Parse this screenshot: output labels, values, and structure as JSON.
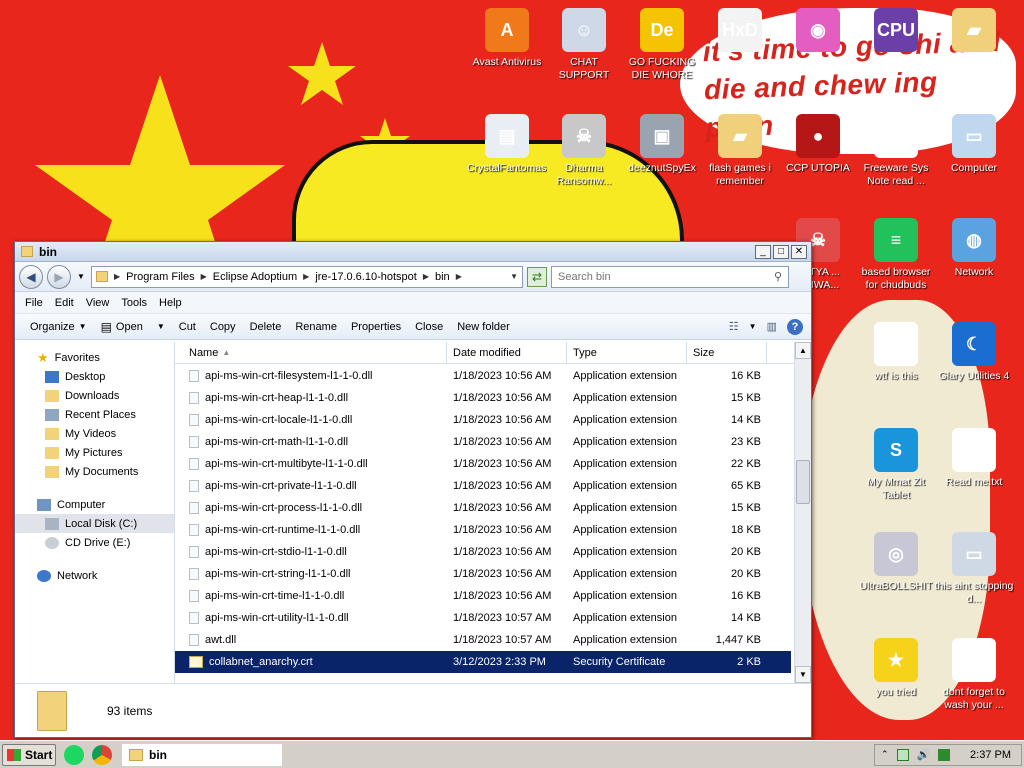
{
  "desktop": {
    "wallpaper_text": "it's time to go shi and die and chew ing pillin",
    "icons": [
      {
        "name": "avast-antivirus-icon",
        "label": "Avast Antivirus",
        "glyph": "A",
        "color": "#f07a1a"
      },
      {
        "name": "chat-support-icon",
        "label": "CHAT SUPPORT",
        "glyph": "☺",
        "color": "#cfd8e6"
      },
      {
        "name": "go-fucking-die-whore-icon",
        "label": "GO FUCKING DIE WHORE",
        "glyph": "De",
        "color": "#f5c400"
      },
      {
        "name": "hxd-icon",
        "label": "",
        "glyph": "HxD",
        "color": "#f3f3f3"
      },
      {
        "name": "colorful-app-icon",
        "label": "",
        "glyph": "◉",
        "color": "#e45ec2"
      },
      {
        "name": "cpu-z-icon",
        "label": "",
        "glyph": "CPU",
        "color": "#6b3fa8"
      },
      {
        "name": "user-folder-icon",
        "label": "",
        "glyph": "▰",
        "color": "#f0d07a"
      },
      {
        "name": "crystal-fantomas-icon",
        "label": "CrystalFantomasR...",
        "glyph": "▤",
        "color": "#e9eef4"
      },
      {
        "name": "dharma-ransomware-icon",
        "label": "Dharma Ransomw...",
        "glyph": "☠",
        "color": "#c8c8c8"
      },
      {
        "name": "deeznut-spyex-icon",
        "label": "deeznutSpyEx",
        "glyph": "▣",
        "color": "#9aa4b0"
      },
      {
        "name": "flash-games-icon",
        "label": "flash games i remember",
        "glyph": "▰",
        "color": "#f0d07a"
      },
      {
        "name": "ccp-utopia-icon",
        "label": "CCP UTOPIA",
        "glyph": "●",
        "color": "#b51616"
      },
      {
        "name": "freeware-sys-note-icon",
        "label": "Freeware Sys Note read ...",
        "glyph": "▯",
        "color": "#ffffff"
      },
      {
        "name": "computer-icon",
        "label": "Computer",
        "glyph": "▭",
        "color": "#bfd8ef"
      },
      {
        "name": "katya-ransomware-icon",
        "label": "KATYA ... ОМWA...",
        "glyph": "☠",
        "color": "#e24a4a"
      },
      {
        "name": "browser-chudbuds-icon",
        "label": "based browser for chudbuds",
        "glyph": "≡",
        "color": "#23c15b"
      },
      {
        "name": "network-icon",
        "label": "Network",
        "glyph": "◍",
        "color": "#5aa3e0"
      },
      {
        "name": "wtf-is-this-icon",
        "label": "wtf is this",
        "glyph": "▦",
        "color": "#ffffff"
      },
      {
        "name": "glary-utilities-icon",
        "label": "Glary Utilities 4",
        "glyph": "☾",
        "color": "#1b6ed1"
      },
      {
        "name": "my-mmat-zit-icon",
        "label": "My Mmat Zit Tablet",
        "glyph": "S",
        "color": "#1a95dc"
      },
      {
        "name": "read-me-icon",
        "label": "Read me.txt",
        "glyph": "▯",
        "color": "#ffffff"
      },
      {
        "name": "ultrabollshit-icon",
        "label": "UltraBOLLSHIT",
        "glyph": "◎",
        "color": "#c7c7d6"
      },
      {
        "name": "this-aint-stopping-icon",
        "label": "this aint stopping d...",
        "glyph": "▭",
        "color": "#cfd9e6"
      },
      {
        "name": "you-tried-icon",
        "label": "you tried",
        "glyph": "★",
        "color": "#f7d21a"
      },
      {
        "name": "dont-forget-icon",
        "label": "dont forget to wash your ...",
        "glyph": "▦",
        "color": "#ffffff"
      }
    ]
  },
  "window": {
    "title": "bin",
    "close_glyph": "✕",
    "max_glyph": "□",
    "min_glyph": "_",
    "breadcrumb": [
      "Program Files",
      "Eclipse Adoptium",
      "jre-17.0.6.10-hotspot",
      "bin"
    ],
    "search_placeholder": "Search bin",
    "menu": [
      "File",
      "Edit",
      "View",
      "Tools",
      "Help"
    ],
    "toolbar": {
      "organize": "Organize",
      "open": "Open",
      "cut": "Cut",
      "copy": "Copy",
      "delete": "Delete",
      "rename": "Rename",
      "properties": "Properties",
      "close": "Close",
      "new_folder": "New folder"
    },
    "nav": {
      "favorites_header": "Favorites",
      "favorites": [
        "Desktop",
        "Downloads",
        "Recent Places",
        "My Videos",
        "My Pictures",
        "My Documents"
      ],
      "computer_header": "Computer",
      "drives": [
        "Local Disk (C:)",
        "CD Drive (E:)"
      ],
      "network": "Network"
    },
    "columns": {
      "name": "Name",
      "date": "Date modified",
      "type": "Type",
      "size": "Size"
    },
    "files": [
      {
        "name": "api-ms-win-crt-filesystem-l1-1-0.dll",
        "date": "1/18/2023 10:56 AM",
        "type": "Application extension",
        "size": "16 KB"
      },
      {
        "name": "api-ms-win-crt-heap-l1-1-0.dll",
        "date": "1/18/2023 10:56 AM",
        "type": "Application extension",
        "size": "15 KB"
      },
      {
        "name": "api-ms-win-crt-locale-l1-1-0.dll",
        "date": "1/18/2023 10:56 AM",
        "type": "Application extension",
        "size": "14 KB"
      },
      {
        "name": "api-ms-win-crt-math-l1-1-0.dll",
        "date": "1/18/2023 10:56 AM",
        "type": "Application extension",
        "size": "23 KB"
      },
      {
        "name": "api-ms-win-crt-multibyte-l1-1-0.dll",
        "date": "1/18/2023 10:56 AM",
        "type": "Application extension",
        "size": "22 KB"
      },
      {
        "name": "api-ms-win-crt-private-l1-1-0.dll",
        "date": "1/18/2023 10:56 AM",
        "type": "Application extension",
        "size": "65 KB"
      },
      {
        "name": "api-ms-win-crt-process-l1-1-0.dll",
        "date": "1/18/2023 10:56 AM",
        "type": "Application extension",
        "size": "15 KB"
      },
      {
        "name": "api-ms-win-crt-runtime-l1-1-0.dll",
        "date": "1/18/2023 10:56 AM",
        "type": "Application extension",
        "size": "18 KB"
      },
      {
        "name": "api-ms-win-crt-stdio-l1-1-0.dll",
        "date": "1/18/2023 10:56 AM",
        "type": "Application extension",
        "size": "20 KB"
      },
      {
        "name": "api-ms-win-crt-string-l1-1-0.dll",
        "date": "1/18/2023 10:56 AM",
        "type": "Application extension",
        "size": "20 KB"
      },
      {
        "name": "api-ms-win-crt-time-l1-1-0.dll",
        "date": "1/18/2023 10:56 AM",
        "type": "Application extension",
        "size": "16 KB"
      },
      {
        "name": "api-ms-win-crt-utility-l1-1-0.dll",
        "date": "1/18/2023 10:57 AM",
        "type": "Application extension",
        "size": "14 KB"
      },
      {
        "name": "awt.dll",
        "date": "1/18/2023 10:57 AM",
        "type": "Application extension",
        "size": "1,447 KB"
      },
      {
        "name": "collabnet_anarchy.crt",
        "date": "3/12/2023 2:33 PM",
        "type": "Security Certificate",
        "size": "2 KB",
        "selected": true
      }
    ],
    "item_count": "93 items"
  },
  "taskbar": {
    "start": "Start",
    "active_task": "bin",
    "clock": "2:37 PM"
  }
}
